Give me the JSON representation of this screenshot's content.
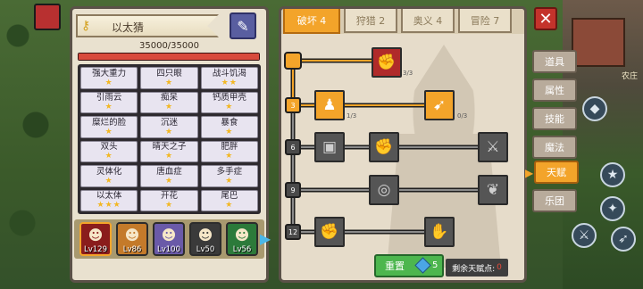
{
  "character": {
    "name": "以太猜",
    "hp_text": "35000/35000",
    "hp_fraction": 1.0
  },
  "traits": [
    {
      "name": "强大重力",
      "stars": 1
    },
    {
      "name": "四只眼",
      "stars": 1
    },
    {
      "name": "战斗饥渴",
      "stars": 2
    },
    {
      "name": "引雨云",
      "stars": 1
    },
    {
      "name": "痴呆",
      "stars": 1
    },
    {
      "name": "钙质甲壳",
      "stars": 1
    },
    {
      "name": "糜烂的脸",
      "stars": 1
    },
    {
      "name": "沉迷",
      "stars": 1
    },
    {
      "name": "暴食",
      "stars": 1
    },
    {
      "name": "双头",
      "stars": 1
    },
    {
      "name": "晴天之子",
      "stars": 1
    },
    {
      "name": "肥胖",
      "stars": 1
    },
    {
      "name": "灵体化",
      "stars": 1
    },
    {
      "name": "唐血症",
      "stars": 1
    },
    {
      "name": "多手症",
      "stars": 1
    },
    {
      "name": "以太体",
      "stars": 3
    },
    {
      "name": "开花",
      "stars": 1
    },
    {
      "name": "尾巴",
      "stars": 1
    }
  ],
  "roster": [
    {
      "level": "Lv129",
      "color": "#8a1c1c",
      "icon": "☻"
    },
    {
      "level": "Lv86",
      "color": "#c47a2a",
      "icon": "☻"
    },
    {
      "level": "Lv100",
      "color": "#6a5aa8",
      "icon": "☻"
    },
    {
      "level": "Lv50",
      "color": "#3a3a3a",
      "icon": "☻"
    },
    {
      "level": "Lv56",
      "color": "#2c7a3a",
      "icon": "☻"
    }
  ],
  "tabs": [
    "破坏 4",
    "狩猎 2",
    "奥义 4",
    "冒险 7"
  ],
  "talent_nodes": {
    "top_count": "3/3",
    "row1_left_count": "1/3",
    "row1_right_count": "0/3"
  },
  "level_markers": [
    "3",
    "6",
    "9",
    "12"
  ],
  "reset": {
    "label": "重置",
    "cost": "5"
  },
  "points": {
    "label": "剩余天赋点:",
    "value": "0"
  },
  "side_tabs": [
    "道具",
    "属性",
    "技能",
    "魔法",
    "天赋",
    "乐团"
  ],
  "scene": {
    "label": "农庄"
  },
  "icons": {
    "close": "close-icon",
    "edit": "edit-icon",
    "key": "key-icon",
    "gem": "gem-icon"
  },
  "colors": {
    "accent": "#f3a42a",
    "hp": "#d84a3c",
    "reset": "#4db64e",
    "close": "#c4332b"
  }
}
